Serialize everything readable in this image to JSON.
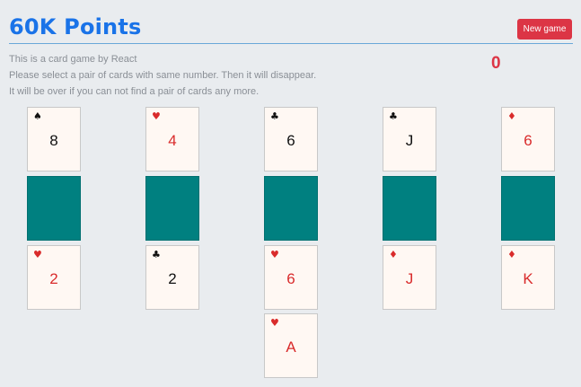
{
  "header": {
    "title": "60K Points",
    "new_game_label": "New game",
    "score": "0"
  },
  "description": {
    "lines": [
      "This is a card game by React",
      "Please select a pair of cards with same number. Then it will disappear.",
      "It will be over if you can not find a pair of cards any more."
    ]
  },
  "colors": {
    "title": "#1a73e8",
    "accent_red": "#dc3545",
    "card_back": "#008080",
    "card_face": "#fff8f3",
    "suit_red": "#d92b2b"
  },
  "rows": [
    [
      {
        "rank": "8",
        "suit": "spade",
        "symbol": "♠",
        "face_up": true
      },
      {
        "rank": "4",
        "suit": "heart",
        "symbol": "♥",
        "face_up": true
      },
      {
        "rank": "6",
        "suit": "club",
        "symbol": "♣",
        "face_up": true
      },
      {
        "rank": "J",
        "suit": "club",
        "symbol": "♣",
        "face_up": true
      },
      {
        "rank": "6",
        "suit": "diamond",
        "symbol": "♦",
        "face_up": true
      }
    ],
    [
      {
        "face_up": false
      },
      {
        "face_up": false
      },
      {
        "face_up": false
      },
      {
        "face_up": false
      },
      {
        "face_up": false
      }
    ],
    [
      {
        "rank": "2",
        "suit": "heart",
        "symbol": "♥",
        "face_up": true
      },
      {
        "rank": "2",
        "suit": "club",
        "symbol": "♣",
        "face_up": true
      },
      {
        "rank": "6",
        "suit": "heart",
        "symbol": "♥",
        "face_up": true
      },
      {
        "rank": "J",
        "suit": "diamond",
        "symbol": "♦",
        "face_up": true
      },
      {
        "rank": "K",
        "suit": "diamond",
        "symbol": "♦",
        "face_up": true
      }
    ],
    [
      null,
      null,
      {
        "rank": "A",
        "suit": "heart",
        "symbol": "♥",
        "face_up": true
      },
      null,
      null
    ]
  ]
}
